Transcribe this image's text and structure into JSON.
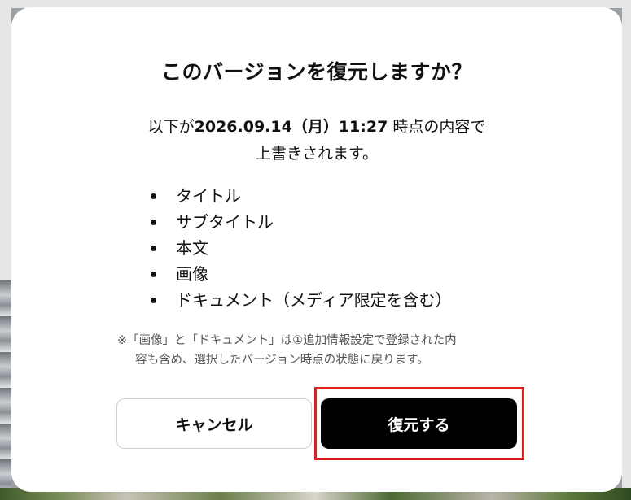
{
  "dialog": {
    "title": "このバージョンを復元しますか？",
    "description": {
      "prefix": "以下が",
      "datetime": "2026.09.14（月）11:27",
      "suffix": " 時点の内容で",
      "line2": "上書きされます。"
    },
    "items": [
      "タイトル",
      "サブタイトル",
      "本文",
      "画像",
      "ドキュメント（メディア限定を含む）"
    ],
    "note": {
      "line1": "※「画像」と「ドキュメント」は①追加情報設定で登録された内",
      "line2": "容も含め、選択したバージョン時点の状態に戻ります。"
    },
    "buttons": {
      "cancel_label": "キャンセル",
      "restore_label": "復元する"
    },
    "colors": {
      "restore_button_bg": "#000000",
      "highlight_outline": "#e02020"
    }
  }
}
